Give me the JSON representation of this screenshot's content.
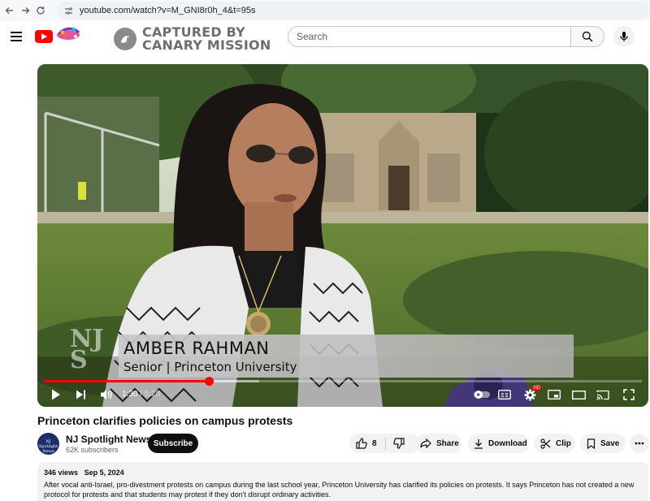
{
  "browser": {
    "url": "youtube.com/watch?v=M_GNI8r0h_4&t=95s"
  },
  "header": {
    "overlay_line1": "CAPTURED BY",
    "overlay_line2": "CANARY MISSION",
    "search_placeholder": "Search"
  },
  "video": {
    "lower_third_name": "AMBER RAHMAN",
    "lower_third_title": "Senior | Princeton University",
    "watermark_line1": "NJ",
    "watermark_line2": "S",
    "current_time": "1:30",
    "separator": "/",
    "duration": "5:25",
    "progress_fraction": 0.277,
    "buffered_fraction": 0.36,
    "hd_label": "HD"
  },
  "details": {
    "title": "Princeton clarifies policies on campus protests",
    "channel_name": "NJ Spotlight News",
    "subscribers": "62K subscribers",
    "avatar_text": "NJ Spotlight News",
    "subscribe_label": "Subscribe",
    "like_count": "8",
    "share_label": "Share",
    "download_label": "Download",
    "clip_label": "Clip",
    "save_label": "Save",
    "views": "346 views",
    "date": "Sep 5, 2024",
    "description": "After vocal anti-Israel, pro-divestment protests on campus during the last school year, Princeton University has clarified its policies on protests. It says Princeton has not created a new protocol for protests and that students may protest if they don't disrupt ordinary activities."
  },
  "colors": {
    "accent_red": "#ff0000",
    "subscribe_bg": "#0f0f0f",
    "pill_bg": "#f2f2f2"
  }
}
